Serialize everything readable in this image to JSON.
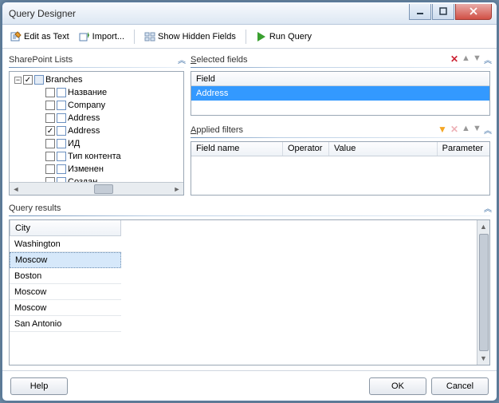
{
  "window": {
    "title": "Query Designer"
  },
  "toolbar": {
    "edit_as_text": "Edit as Text",
    "import": "Import...",
    "show_hidden": "Show Hidden Fields",
    "run_query": "Run Query"
  },
  "panels": {
    "sharepoint_lists": "SharePoint Lists",
    "selected_fields": "Selected fields",
    "applied_filters": "Applied filters",
    "query_results": "Query results"
  },
  "tree": {
    "root": {
      "label": "Branches",
      "expanded": true,
      "checked": true
    },
    "children": [
      {
        "label": "Название",
        "checked": false
      },
      {
        "label": "Company",
        "checked": false
      },
      {
        "label": "Address",
        "checked": false
      },
      {
        "label": "Address",
        "checked": true
      },
      {
        "label": "ИД",
        "checked": false
      },
      {
        "label": "Тип контента",
        "checked": false
      },
      {
        "label": "Изменен",
        "checked": false
      },
      {
        "label": "Создан",
        "checked": false
      }
    ]
  },
  "selected_fields": {
    "header": "Field",
    "rows": [
      "Address"
    ]
  },
  "filters": {
    "cols": {
      "name": "Field name",
      "operator": "Operator",
      "value": "Value",
      "parameter": "Parameter"
    }
  },
  "results": {
    "column": "City",
    "rows": [
      "Washington",
      "Moscow",
      "Boston",
      "Moscow",
      "Moscow",
      "San Antonio"
    ],
    "selected_index": 1
  },
  "buttons": {
    "help": "Help",
    "ok": "OK",
    "cancel": "Cancel"
  }
}
